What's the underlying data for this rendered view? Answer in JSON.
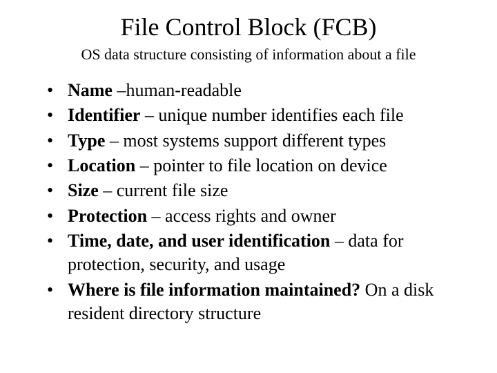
{
  "title": "File Control Block (FCB)",
  "subtitle": "OS data structure consisting of information about a file",
  "items": [
    {
      "term": "Name",
      "desc": " –human-readable"
    },
    {
      "term": "Identifier",
      "desc": " – unique number identifies each file"
    },
    {
      "term": "Type",
      "desc": " – most systems support different types"
    },
    {
      "term": "Location",
      "desc": " – pointer to file location on device"
    },
    {
      "term": "Size",
      "desc": " – current file size"
    },
    {
      "term": "Protection",
      "desc": " – access rights and owner"
    },
    {
      "term": "Time, date, and user identification",
      "desc": " – data for protection, security, and usage"
    },
    {
      "term": "Where is file information maintained?",
      "desc": " On a disk resident directory structure"
    }
  ]
}
